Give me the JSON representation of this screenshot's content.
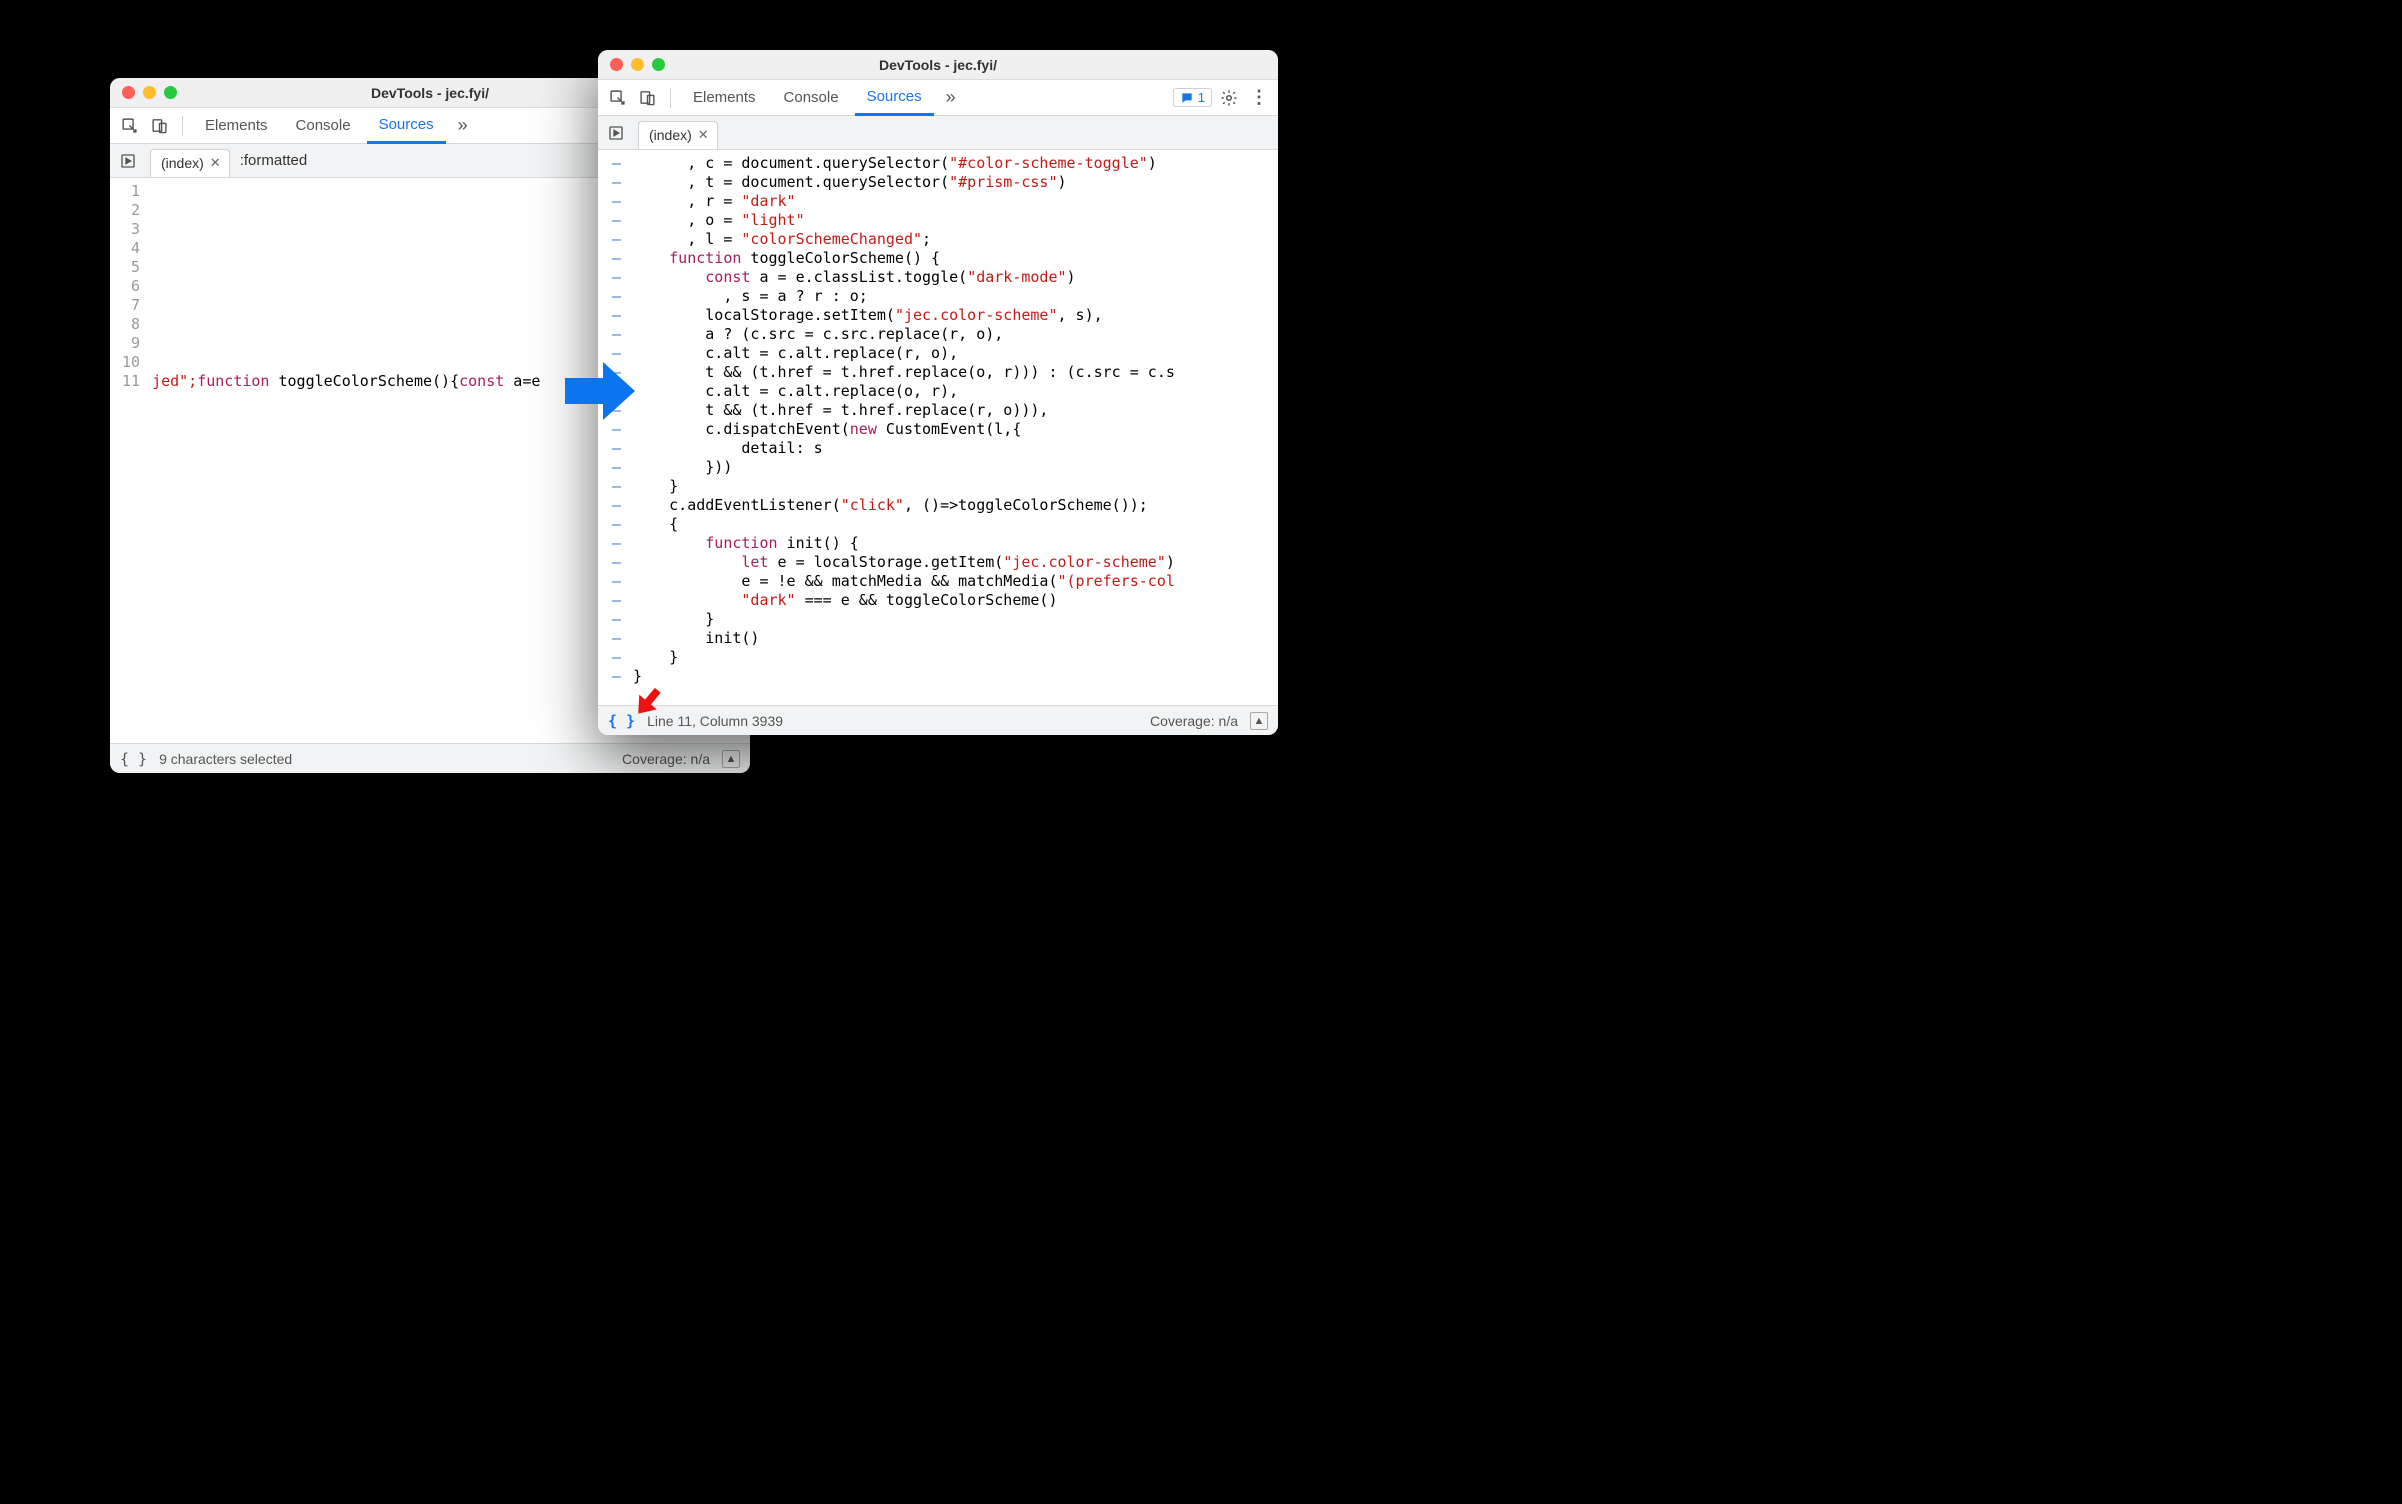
{
  "window_back": {
    "title": "DevTools - jec.fyi/",
    "tabs": {
      "elements": "Elements",
      "console": "Console",
      "sources": "Sources"
    },
    "file_tab": "(index)",
    "extra_tab": ":formatted",
    "line_numbers": [
      "1",
      "2",
      "3",
      "4",
      "5",
      "6",
      "7",
      "8",
      "9",
      "10",
      "11"
    ],
    "code_line_11": {
      "frag": "jed\";",
      "kw1": "function",
      "fn": " toggleColorScheme(){",
      "kw2": "const",
      "rest": " a=e"
    },
    "footer_pp": "{ }",
    "footer_status": "9 characters selected",
    "footer_coverage": "Coverage: n/a"
  },
  "window_front": {
    "title": "DevTools - jec.fyi/",
    "tabs": {
      "elements": "Elements",
      "console": "Console",
      "sources": "Sources"
    },
    "issues_count": "1",
    "file_tab": "(index)",
    "code_lines": [
      [
        [
          "p",
          "      , c = document.querySelector("
        ],
        [
          "s",
          "\"#color-scheme-toggle\""
        ],
        [
          "p",
          ")"
        ]
      ],
      [
        [
          "p",
          "      , t = document.querySelector("
        ],
        [
          "s",
          "\"#prism-css\""
        ],
        [
          "p",
          ")"
        ]
      ],
      [
        [
          "p",
          "      , r = "
        ],
        [
          "s",
          "\"dark\""
        ]
      ],
      [
        [
          "p",
          "      , o = "
        ],
        [
          "s",
          "\"light\""
        ]
      ],
      [
        [
          "p",
          "      , l = "
        ],
        [
          "s",
          "\"colorSchemeChanged\""
        ],
        [
          "p",
          ";"
        ]
      ],
      [
        [
          "k",
          "    function"
        ],
        [
          "p",
          " toggleColorScheme() {"
        ]
      ],
      [
        [
          "k",
          "        const"
        ],
        [
          "p",
          " a = e.classList.toggle("
        ],
        [
          "s",
          "\"dark-mode\""
        ],
        [
          "p",
          ")"
        ]
      ],
      [
        [
          "p",
          "          , s = a ? r : o;"
        ]
      ],
      [
        [
          "p",
          "        localStorage.setItem("
        ],
        [
          "s",
          "\"jec.color-scheme\""
        ],
        [
          "p",
          ", s),"
        ]
      ],
      [
        [
          "p",
          "        a ? (c.src = c.src.replace(r, o),"
        ]
      ],
      [
        [
          "p",
          "        c.alt = c.alt.replace(r, o),"
        ]
      ],
      [
        [
          "p",
          "        t && (t.href = t.href.replace(o, r))) : (c.src = c.s"
        ]
      ],
      [
        [
          "p",
          "        c.alt = c.alt.replace(o, r),"
        ]
      ],
      [
        [
          "p",
          "        t && (t.href = t.href.replace(r, o))),"
        ]
      ],
      [
        [
          "p",
          "        c.dispatchEvent("
        ],
        [
          "k",
          "new"
        ],
        [
          "p",
          " CustomEvent(l,{"
        ]
      ],
      [
        [
          "p",
          "            detail: s"
        ]
      ],
      [
        [
          "p",
          "        }))"
        ]
      ],
      [
        [
          "p",
          "    }"
        ]
      ],
      [
        [
          "p",
          "    c.addEventListener("
        ],
        [
          "s",
          "\"click\""
        ],
        [
          "p",
          ", ()=>toggleColorScheme());"
        ]
      ],
      [
        [
          "p",
          "    {"
        ]
      ],
      [
        [
          "k",
          "        function"
        ],
        [
          "p",
          " init() {"
        ]
      ],
      [
        [
          "k",
          "            let"
        ],
        [
          "p",
          " e = localStorage.getItem("
        ],
        [
          "s",
          "\"jec.color-scheme\""
        ],
        [
          "p",
          ")"
        ]
      ],
      [
        [
          "p",
          "            e = !e && matchMedia && matchMedia("
        ],
        [
          "s",
          "\"(prefers-col"
        ]
      ],
      [
        [
          "p",
          "            "
        ],
        [
          "s",
          "\"dark\""
        ],
        [
          "p",
          " === e && toggleColorScheme()"
        ]
      ],
      [
        [
          "p",
          "        }"
        ]
      ],
      [
        [
          "p",
          "        init()"
        ]
      ],
      [
        [
          "p",
          "    }"
        ]
      ],
      [
        [
          "p",
          "}"
        ]
      ]
    ],
    "footer_pp": "{ }",
    "footer_status": "Line 11, Column 3939",
    "footer_coverage": "Coverage: n/a"
  }
}
